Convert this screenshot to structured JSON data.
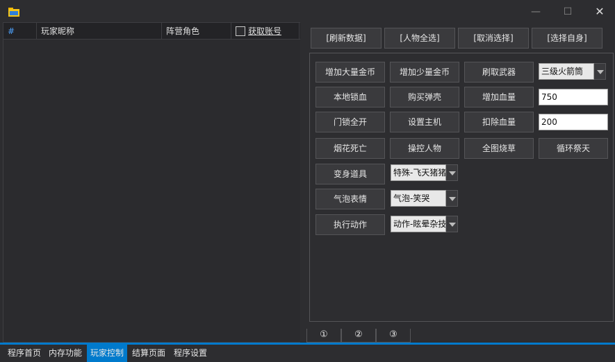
{
  "window": {
    "min_glyph": "—",
    "max_glyph": "☐",
    "close_glyph": "✕"
  },
  "table": {
    "col_index": "#",
    "col_nickname": "玩家昵称",
    "col_camp": "阵营角色",
    "col_fetch_account": "获取账号"
  },
  "top_buttons": {
    "refresh": "[刷新数据]",
    "select_all": "[人物全选]",
    "cancel_select": "[取消选择]",
    "select_self": "[选择自身]"
  },
  "controls": {
    "add_gold_large": "增加大量金币",
    "add_gold_small": "增加少量金币",
    "refresh_weapon": "刷取武器",
    "weapon_select": "三级火箭筒",
    "local_lock_hp": "本地锁血",
    "buy_ammo": "购买弹壳",
    "add_hp": "增加血量",
    "add_hp_value": "750",
    "open_all_locks": "门锁全开",
    "set_host": "设置主机",
    "deduct_hp": "扣除血量",
    "deduct_hp_value": "200",
    "firework_death": "烟花死亡",
    "control_character": "操控人物",
    "burn_map_grass": "全图烧草",
    "loop_sacrifice": "循环祭天",
    "transform_item": "变身道具",
    "transform_select": "特殊-飞天猪猪",
    "bubble_emote": "气泡表情",
    "bubble_select": "气泡-笑哭",
    "perform_action": "执行动作",
    "action_select": "动作-眩晕杂技"
  },
  "tabs": [
    "①",
    "②",
    "③"
  ],
  "bottom_nav": [
    "程序首页",
    "内存功能",
    "玩家控制",
    "结算页面",
    "程序设置"
  ],
  "colors": {
    "accent": "#007acc",
    "background": "#2d2d30"
  }
}
